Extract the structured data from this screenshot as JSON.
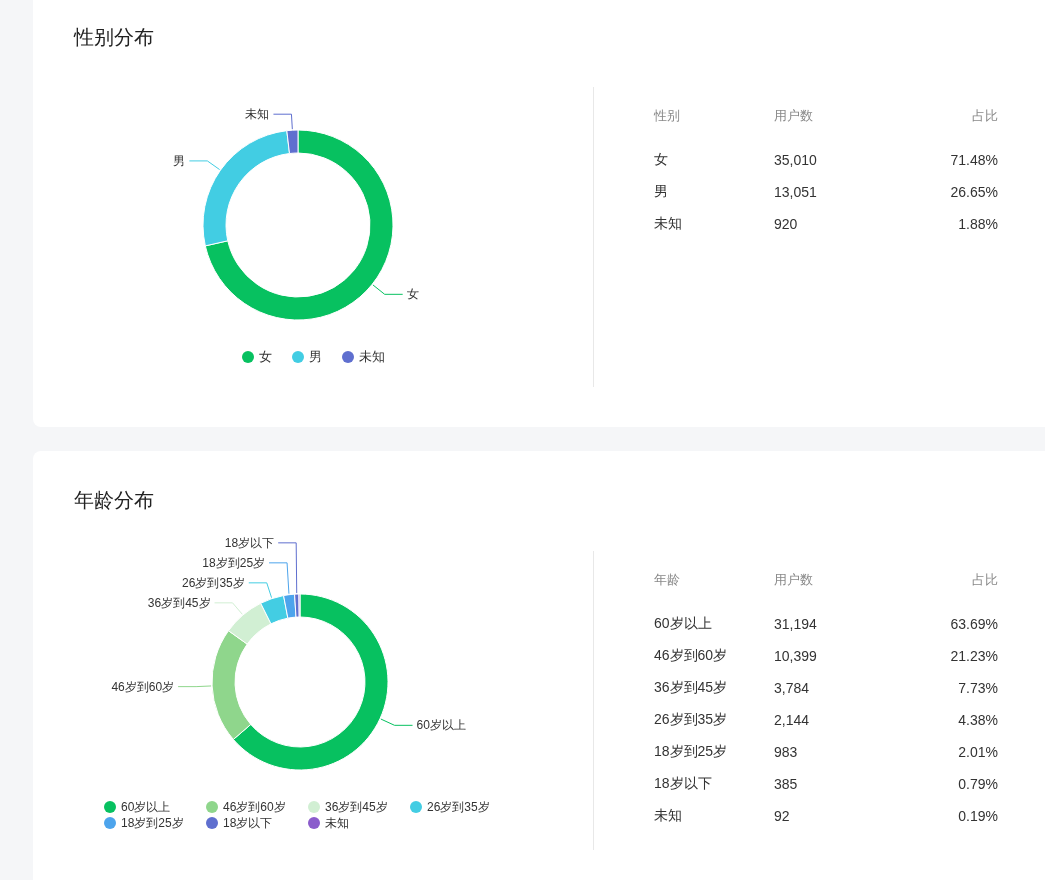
{
  "sections": [
    {
      "title": "性别分布",
      "chart_data": {
        "type": "donut",
        "categories": [
          "女",
          "男",
          "未知"
        ],
        "colors": [
          "#07c160",
          "#42cde3",
          "#5f6fcf"
        ],
        "values": [
          71.48,
          26.65,
          1.88
        ]
      },
      "table": {
        "columns": [
          "性别",
          "用户数",
          "占比"
        ],
        "rows": [
          [
            "女",
            "35,010",
            "71.48%"
          ],
          [
            "男",
            "13,051",
            "26.65%"
          ],
          [
            "未知",
            "920",
            "1.88%"
          ]
        ]
      }
    },
    {
      "title": "年龄分布",
      "chart_data": {
        "type": "donut",
        "categories": [
          "60岁以上",
          "46岁到60岁",
          "36岁到45岁",
          "26岁到35岁",
          "18岁到25岁",
          "18岁以下",
          "未知"
        ],
        "colors": [
          "#07c160",
          "#8fd68c",
          "#d1efd3",
          "#43cde3",
          "#4da4ec",
          "#5f6fcf",
          "#8b5ccc"
        ],
        "values": [
          63.69,
          21.23,
          7.73,
          4.38,
          2.01,
          0.79,
          0.19
        ]
      },
      "table": {
        "columns": [
          "年龄",
          "用户数",
          "占比"
        ],
        "rows": [
          [
            "60岁以上",
            "31,194",
            "63.69%"
          ],
          [
            "46岁到60岁",
            "10,399",
            "21.23%"
          ],
          [
            "36岁到45岁",
            "3,784",
            "7.73%"
          ],
          [
            "26岁到35岁",
            "2,144",
            "4.38%"
          ],
          [
            "18岁到25岁",
            "983",
            "2.01%"
          ],
          [
            "18岁以下",
            "385",
            "0.79%"
          ],
          [
            "未知",
            "92",
            "0.19%"
          ]
        ]
      }
    }
  ]
}
